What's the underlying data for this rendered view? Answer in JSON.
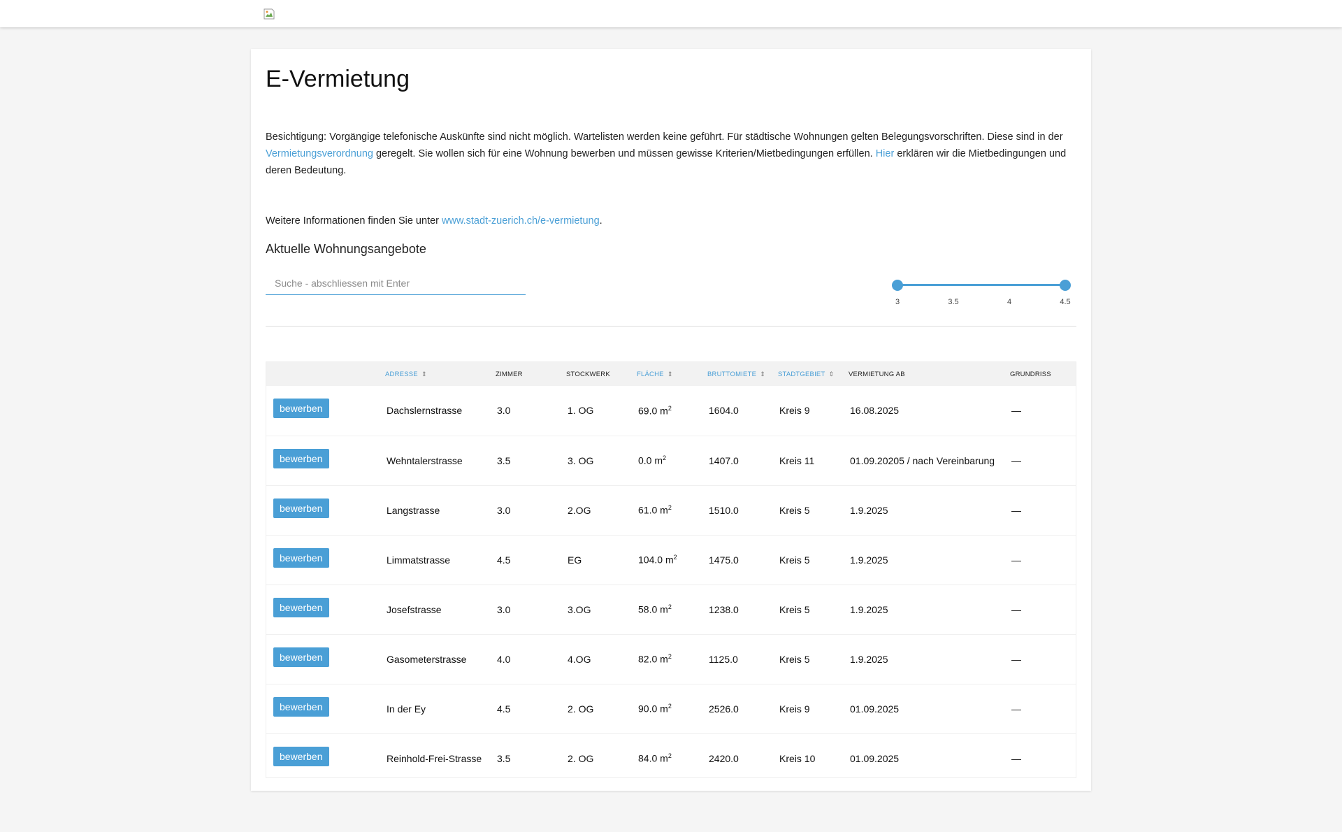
{
  "header": {
    "logo_alt": ""
  },
  "page": {
    "title": "E-Vermietung",
    "intro": {
      "part1": "Besichtigung: Vorgängige telefonische Auskünfte sind nicht möglich. Wartelisten werden keine geführt. Für städtische Wohnungen gelten Belegungsvorschriften. Diese sind in der ",
      "link1": "Vermie­tungsverordnung",
      "part2": " geregelt. Sie wollen sich für eine Wohnung bewerben und müssen gewisse Kriterien/Mietbedingungen erfüllen. ",
      "link2": "Hier",
      "part3": " erklären wir die Mietbedingungen und deren Bedeutung."
    },
    "more_info": {
      "prefix": "Weitere Informationen finden Sie unter ",
      "link": "www.stadt-zuerich.ch/e-vermietung",
      "suffix": "."
    },
    "section_title": "Aktuelle Wohnungsangebote"
  },
  "search": {
    "placeholder": "Suche - abschliessen mit Enter",
    "value": ""
  },
  "slider": {
    "min": 3,
    "max": 4.5,
    "selected_min": 3,
    "selected_max": 4.5,
    "ticks": [
      "3",
      "3.5",
      "4",
      "4.5"
    ]
  },
  "table": {
    "columns": {
      "action": "",
      "adresse": "Adresse",
      "zimmer": "Zimmer",
      "stockwerk": "Stockwerk",
      "flaeche": "Fläche",
      "bruttomiete": "Bruttomiete",
      "stadtgebiet": "Stadtgebiet",
      "vermietung_ab": "Vermietung ab",
      "grundriss": "Grundriss"
    },
    "button_label": "bewerben",
    "area_unit": "m",
    "area_sup": "2",
    "rows": [
      {
        "adresse": "Dachslernstrasse",
        "zimmer": "3.0",
        "stockwerk": "1. OG",
        "flaeche": "69.0",
        "bruttomiete": "1604.0",
        "stadtgebiet": "Kreis 9",
        "vermietung_ab": "16.08.2025",
        "grundriss": "—"
      },
      {
        "adresse": "Wehntalerstrasse",
        "zimmer": "3.5",
        "stockwerk": "3. OG",
        "flaeche": "0.0",
        "bruttomiete": "1407.0",
        "stadtgebiet": "Kreis 11",
        "vermietung_ab": "01.09.20205 / nach Vereinbarung",
        "grundriss": "—"
      },
      {
        "adresse": "Langstrasse",
        "zimmer": "3.0",
        "stockwerk": "2.OG",
        "flaeche": "61.0",
        "bruttomiete": "1510.0",
        "stadtgebiet": "Kreis 5",
        "vermietung_ab": "1.9.2025",
        "grundriss": "—"
      },
      {
        "adresse": "Limmatstrasse",
        "zimmer": "4.5",
        "stockwerk": "EG",
        "flaeche": "104.0",
        "bruttomiete": "1475.0",
        "stadtgebiet": "Kreis 5",
        "vermietung_ab": "1.9.2025",
        "grundriss": "—"
      },
      {
        "adresse": "Josefstrasse",
        "zimmer": "3.0",
        "stockwerk": "3.OG",
        "flaeche": "58.0",
        "bruttomiete": "1238.0",
        "stadtgebiet": "Kreis 5",
        "vermietung_ab": "1.9.2025",
        "grundriss": "—"
      },
      {
        "adresse": "Gasometerstrasse",
        "zimmer": "4.0",
        "stockwerk": "4.OG",
        "flaeche": "82.0",
        "bruttomiete": "1125.0",
        "stadtgebiet": "Kreis 5",
        "vermietung_ab": "1.9.2025",
        "grundriss": "—"
      },
      {
        "adresse": "In der Ey",
        "zimmer": "4.5",
        "stockwerk": "2. OG",
        "flaeche": "90.0",
        "bruttomiete": "2526.0",
        "stadtgebiet": "Kreis 9",
        "vermietung_ab": "01.09.2025",
        "grundriss": "—"
      },
      {
        "adresse": "Reinhold-Frei-Strasse",
        "zimmer": "3.5",
        "stockwerk": "2. OG",
        "flaeche": "84.0",
        "bruttomiete": "2420.0",
        "stadtgebiet": "Kreis 10",
        "vermietung_ab": "01.09.2025",
        "grundriss": "—"
      }
    ]
  },
  "colors": {
    "accent": "#4a9fd6",
    "background": "#f5f5f5",
    "header_row": "#f2f2f2"
  },
  "icons": {
    "sort": "sort-icon",
    "logo": "broken-image-icon"
  }
}
